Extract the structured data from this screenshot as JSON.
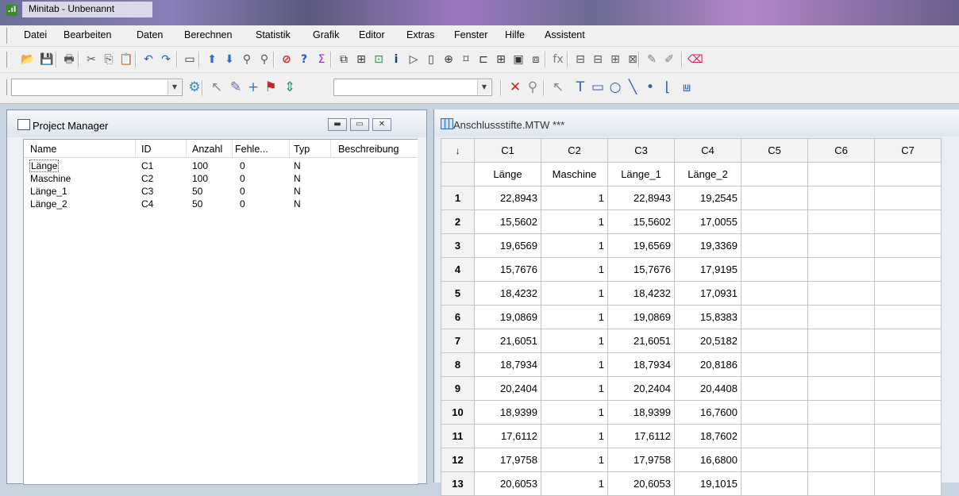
{
  "window": {
    "title": "Minitab - Unbenannt",
    "app_icon": "minitab-icon"
  },
  "menu": [
    "Datei",
    "Bearbeiten",
    "Daten",
    "Berechnen",
    "Statistik",
    "Grafik",
    "Editor",
    "Extras",
    "Fenster",
    "Hilfe",
    "Assistent"
  ],
  "project_manager": {
    "title": "Project Manager",
    "columns": [
      "Name",
      "ID",
      "Anzahl",
      "Fehle...",
      "Typ",
      "Beschreibung"
    ],
    "rows": [
      [
        "Länge",
        "C1",
        "100",
        "0",
        "N",
        ""
      ],
      [
        "Maschine",
        "C2",
        "100",
        "0",
        "N",
        ""
      ],
      [
        "Länge_1",
        "C3",
        "50",
        "0",
        "N",
        ""
      ],
      [
        "Länge_2",
        "C4",
        "50",
        "0",
        "N",
        ""
      ]
    ]
  },
  "worksheet": {
    "title": "Anschlussstifte.MTW ***",
    "corner_symbol": "↓",
    "column_ids": [
      "C1",
      "C2",
      "C3",
      "C4",
      "C5",
      "C6",
      "C7"
    ],
    "column_names": [
      "Länge",
      "Maschine",
      "Länge_1",
      "Länge_2",
      "",
      "",
      ""
    ],
    "rows": [
      [
        "1",
        "22,8943",
        "1",
        "22,8943",
        "19,2545"
      ],
      [
        "2",
        "15,5602",
        "1",
        "15,5602",
        "17,0055"
      ],
      [
        "3",
        "19,6569",
        "1",
        "19,6569",
        "19,3369"
      ],
      [
        "4",
        "15,7676",
        "1",
        "15,7676",
        "17,9195"
      ],
      [
        "5",
        "18,4232",
        "1",
        "18,4232",
        "17,0931"
      ],
      [
        "6",
        "19,0869",
        "1",
        "19,0869",
        "15,8383"
      ],
      [
        "7",
        "21,6051",
        "1",
        "21,6051",
        "20,5182"
      ],
      [
        "8",
        "18,7934",
        "1",
        "18,7934",
        "20,8186"
      ],
      [
        "9",
        "20,2404",
        "1",
        "20,2404",
        "20,4408"
      ],
      [
        "10",
        "18,9399",
        "1",
        "18,9399",
        "16,7600"
      ],
      [
        "11",
        "17,6112",
        "1",
        "17,6112",
        "18,7602"
      ],
      [
        "12",
        "17,9758",
        "1",
        "17,9758",
        "16,6800"
      ],
      [
        "13",
        "20,6053",
        "1",
        "20,6053",
        "19,1015"
      ]
    ]
  },
  "toolbar1_icons": [
    {
      "name": "open-icon",
      "glyph": "📂",
      "color": "#c98a1a"
    },
    {
      "name": "save-icon",
      "glyph": "💾",
      "color": "#1a3ea8"
    },
    {
      "name": "print-icon",
      "glyph": "🖶",
      "color": "#555"
    },
    {
      "name": "cut-icon",
      "glyph": "✂",
      "color": "#555"
    },
    {
      "name": "copy-icon",
      "glyph": "⎘",
      "color": "#555"
    },
    {
      "name": "paste-icon",
      "glyph": "📋",
      "color": "#a07a30"
    },
    {
      "name": "undo-icon",
      "glyph": "↶",
      "color": "#2a5fb0"
    },
    {
      "name": "redo-icon",
      "glyph": "↷",
      "color": "#2a5fb0"
    },
    {
      "name": "window-icon",
      "glyph": "▭",
      "color": "#333"
    },
    {
      "name": "up-arrow-icon",
      "glyph": "⬆",
      "color": "#2a6fd0"
    },
    {
      "name": "down-arrow-icon",
      "glyph": "⬇",
      "color": "#2a6fd0"
    },
    {
      "name": "find-icon",
      "glyph": "⚲",
      "color": "#555"
    },
    {
      "name": "find-next-icon",
      "glyph": "⚲",
      "color": "#555"
    },
    {
      "name": "cancel-icon",
      "glyph": "⊘",
      "color": "#d02020"
    },
    {
      "name": "help-icon",
      "glyph": "?",
      "color": "#1a5fc0"
    },
    {
      "name": "stat-guide-icon",
      "glyph": "Σ",
      "color": "#8a3aa8"
    },
    {
      "name": "session-icon",
      "glyph": "⧉",
      "color": "#333"
    },
    {
      "name": "worksheet-icon",
      "glyph": "⊞",
      "color": "#333"
    },
    {
      "name": "graph-window-icon",
      "glyph": "⊡",
      "color": "#2a8a4a"
    },
    {
      "name": "info-icon",
      "glyph": "i",
      "color": "#1a3a8a"
    },
    {
      "name": "history-icon",
      "glyph": "▷",
      "color": "#333"
    },
    {
      "name": "report-icon",
      "glyph": "▯",
      "color": "#333"
    },
    {
      "name": "related-docs-icon",
      "glyph": "⊕",
      "color": "#333"
    },
    {
      "name": "design-icon",
      "glyph": "⌑",
      "color": "#333"
    },
    {
      "name": "graph-folder-icon",
      "glyph": "⊏",
      "color": "#333"
    },
    {
      "name": "table-icon",
      "glyph": "⊞",
      "color": "#333"
    },
    {
      "name": "sheet-icon",
      "glyph": "▣",
      "color": "#333"
    },
    {
      "name": "close-all-graphs-icon",
      "glyph": "⧈",
      "color": "#333"
    },
    {
      "name": "function-icon",
      "glyph": "fx",
      "color": "#777"
    },
    {
      "name": "insert-cells-icon",
      "glyph": "⊟",
      "color": "#555"
    },
    {
      "name": "insert-rows-icon",
      "glyph": "⊟",
      "color": "#555"
    },
    {
      "name": "insert-columns-icon",
      "glyph": "⊞",
      "color": "#555"
    },
    {
      "name": "move-columns-icon",
      "glyph": "⊠",
      "color": "#555"
    },
    {
      "name": "brush-icon",
      "glyph": "✎",
      "color": "#7a7a7a"
    },
    {
      "name": "set-id-variables-icon",
      "glyph": "✐",
      "color": "#7a7a7a"
    },
    {
      "name": "eraser-icon",
      "glyph": "⌫",
      "color": "#d02060"
    }
  ],
  "toolbar2_icons": [
    {
      "name": "edit-attributes-icon",
      "glyph": "⚙",
      "color": "#3a8ac0"
    },
    {
      "name": "select-icon",
      "glyph": "↖",
      "color": "#888"
    },
    {
      "name": "brush-tool-icon",
      "glyph": "✎",
      "color": "#7a5ac0"
    },
    {
      "name": "crosshairs-icon",
      "glyph": "+",
      "color": "#2a7ad0"
    },
    {
      "name": "flag-icon",
      "glyph": "⚑",
      "color": "#d02020"
    },
    {
      "name": "reposition-icon",
      "glyph": "⇕",
      "color": "#2a9a6a"
    },
    {
      "name": "delete-icon",
      "glyph": "✕",
      "color": "#d02020"
    },
    {
      "name": "zoom-icon",
      "glyph": "⚲",
      "color": "#888"
    },
    {
      "name": "pointer-icon",
      "glyph": "↖",
      "color": "#888"
    },
    {
      "name": "text-tool-icon",
      "glyph": "T",
      "color": "#2a5fb0"
    },
    {
      "name": "rectangle-tool-icon",
      "glyph": "▭",
      "color": "#2a5fb0"
    },
    {
      "name": "ellipse-tool-icon",
      "glyph": "○",
      "color": "#2a5fb0"
    },
    {
      "name": "line-tool-icon",
      "glyph": "╲",
      "color": "#2a5fb0"
    },
    {
      "name": "marker-tool-icon",
      "glyph": "•",
      "color": "#2a5fb0"
    },
    {
      "name": "polyline-tool-icon",
      "glyph": "⌊",
      "color": "#2a5fb0"
    },
    {
      "name": "polygon-tool-icon",
      "glyph": "⩏",
      "color": "#2a5fb0"
    }
  ]
}
